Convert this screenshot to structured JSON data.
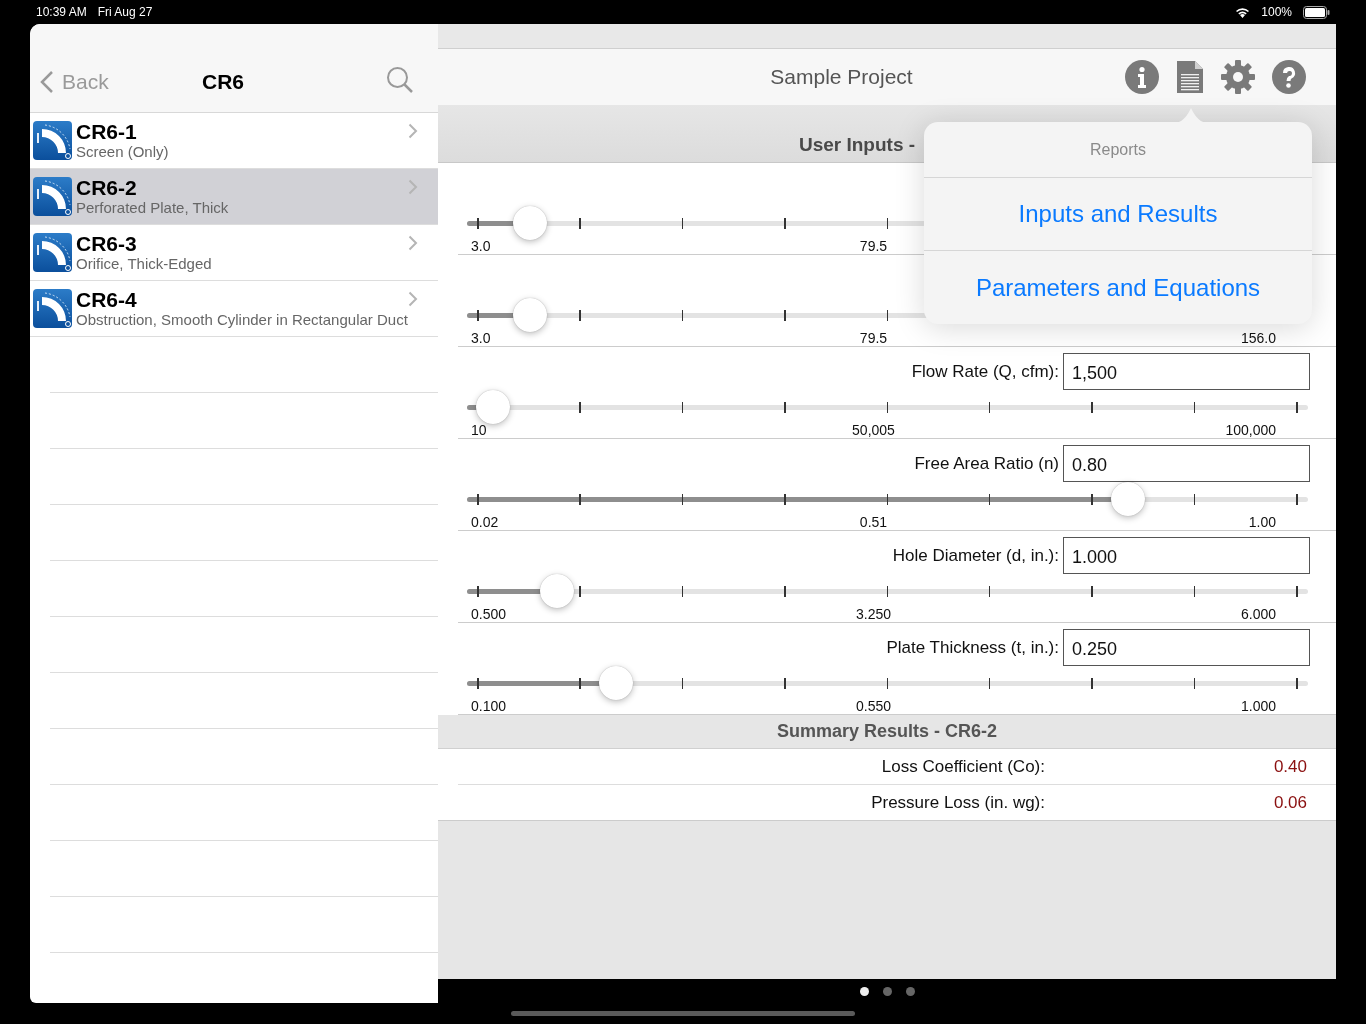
{
  "status_bar": {
    "time": "10:39 AM",
    "date": "Fri Aug 27",
    "battery": "100%"
  },
  "sidebar": {
    "back": "Back",
    "title": "CR6",
    "items": [
      {
        "code": "CR6-1",
        "name": "Screen (Only)",
        "selected": false
      },
      {
        "code": "CR6-2",
        "name": "Perforated Plate, Thick",
        "selected": true
      },
      {
        "code": "CR6-3",
        "name": "Orifice, Thick-Edged",
        "selected": false
      },
      {
        "code": "CR6-4",
        "name": "Obstruction, Smooth Cylinder in Rectangular Duct",
        "selected": false
      }
    ]
  },
  "header": {
    "title": "Sample Project"
  },
  "inputs": {
    "title": "User Inputs -",
    "rows": [
      {
        "min": "3.0",
        "mid": "79.5",
        "level": 0.065
      },
      {
        "min": "3.0",
        "mid": "79.5",
        "max": "156.0",
        "level": 0.065
      },
      {
        "label": "Flow Rate (Q, cfm):",
        "value": "1,500",
        "min": "10",
        "mid": "50,005",
        "max": "100,000",
        "level": 0.02
      },
      {
        "label": "Free Area Ratio (n)",
        "value": "0.80",
        "min": "0.02",
        "mid": "0.51",
        "max": "1.00",
        "level": 0.795
      },
      {
        "label": "Hole Diameter (d, in.):",
        "value": "1.000",
        "min": "0.500",
        "mid": "3.250",
        "max": "6.000",
        "level": 0.098
      },
      {
        "label": "Plate Thickness (t, in.):",
        "value": "0.250",
        "min": "0.100",
        "mid": "0.550",
        "max": "1.000",
        "level": 0.17
      }
    ]
  },
  "summary": {
    "title": "Summary Results - CR6-2",
    "rows": [
      {
        "label": "Loss Coefficient (Co):",
        "value": "0.40"
      },
      {
        "label": "Pressure Loss (in. wg):",
        "value": "0.06"
      }
    ]
  },
  "popover": {
    "title": "Reports",
    "items": [
      "Inputs and Results",
      "Parameters and Equations"
    ]
  },
  "pages": [
    {
      "selected": true
    },
    {
      "selected": false
    },
    {
      "selected": false
    }
  ]
}
